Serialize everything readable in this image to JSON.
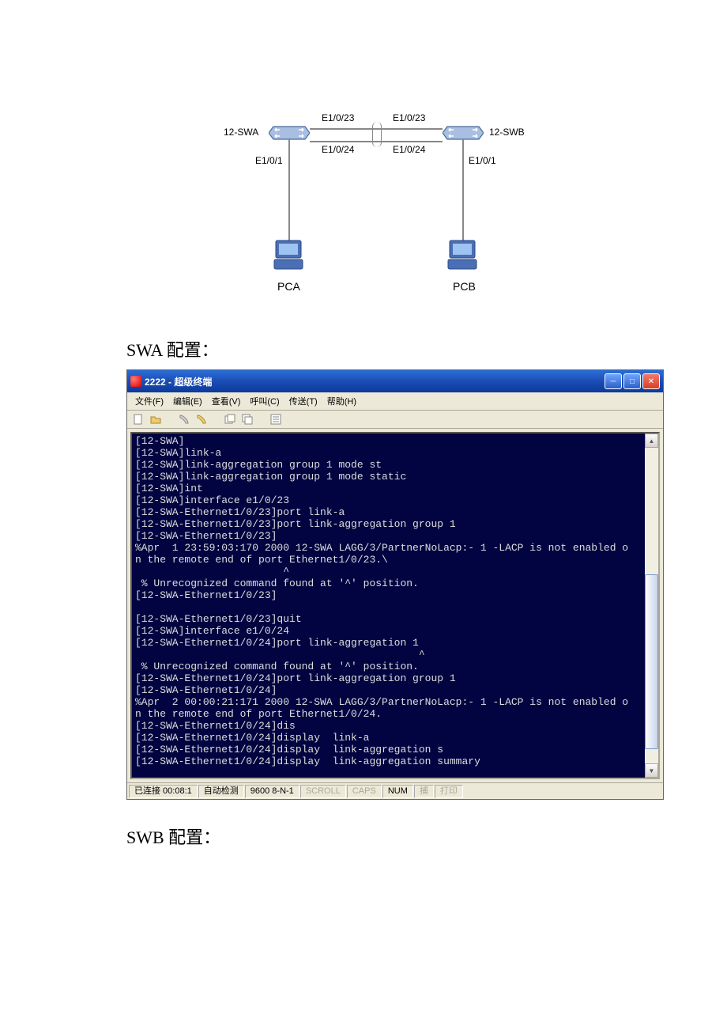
{
  "diagram": {
    "switch_left": "12-SWA",
    "switch_right": "12-SWB",
    "pc_left": "PCA",
    "pc_right": "PCB",
    "port_e1023_l": "E1/0/23",
    "port_e1023_r": "E1/0/23",
    "port_e1024_l": "E1/0/24",
    "port_e1024_r": "E1/0/24",
    "port_e101_l": "E1/0/1",
    "port_e101_r": "E1/0/1"
  },
  "headings": {
    "swa_config": "SWA 配置：",
    "swb_config": "SWB 配置："
  },
  "window": {
    "title": "2222 - 超级终端",
    "menu": {
      "file": "文件(F)",
      "edit": "编辑(E)",
      "view": "查看(V)",
      "call": "呼叫(C)",
      "transfer": "传送(T)",
      "help": "帮助(H)"
    },
    "terminal_text": "[12-SWA]\n[12-SWA]link-a\n[12-SWA]link-aggregation group 1 mode st\n[12-SWA]link-aggregation group 1 mode static\n[12-SWA]int\n[12-SWA]interface e1/0/23\n[12-SWA-Ethernet1/0/23]port link-a\n[12-SWA-Ethernet1/0/23]port link-aggregation group 1\n[12-SWA-Ethernet1/0/23]\n%Apr  1 23:59:03:170 2000 12-SWA LAGG/3/PartnerNoLacp:- 1 -LACP is not enabled o\nn the remote end of port Ethernet1/0/23.\\\n                        ^\n % Unrecognized command found at '^' position.\n[12-SWA-Ethernet1/0/23]\n\n[12-SWA-Ethernet1/0/23]quit\n[12-SWA]interface e1/0/24\n[12-SWA-Ethernet1/0/24]port link-aggregation 1\n                                              ^\n % Unrecognized command found at '^' position.\n[12-SWA-Ethernet1/0/24]port link-aggregation group 1\n[12-SWA-Ethernet1/0/24]\n%Apr  2 00:00:21:171 2000 12-SWA LAGG/3/PartnerNoLacp:- 1 -LACP is not enabled o\nn the remote end of port Ethernet1/0/24.\n[12-SWA-Ethernet1/0/24]dis\n[12-SWA-Ethernet1/0/24]display  link-a\n[12-SWA-Ethernet1/0/24]display  link-aggregation s\n[12-SWA-Ethernet1/0/24]display  link-aggregation summary",
    "status": {
      "connected": "已连接 00:08:1",
      "detect": "自动检测",
      "baud": "9600 8-N-1",
      "scroll": "SCROLL",
      "caps": "CAPS",
      "num": "NUM",
      "capture": "捕",
      "print": "打印"
    }
  }
}
